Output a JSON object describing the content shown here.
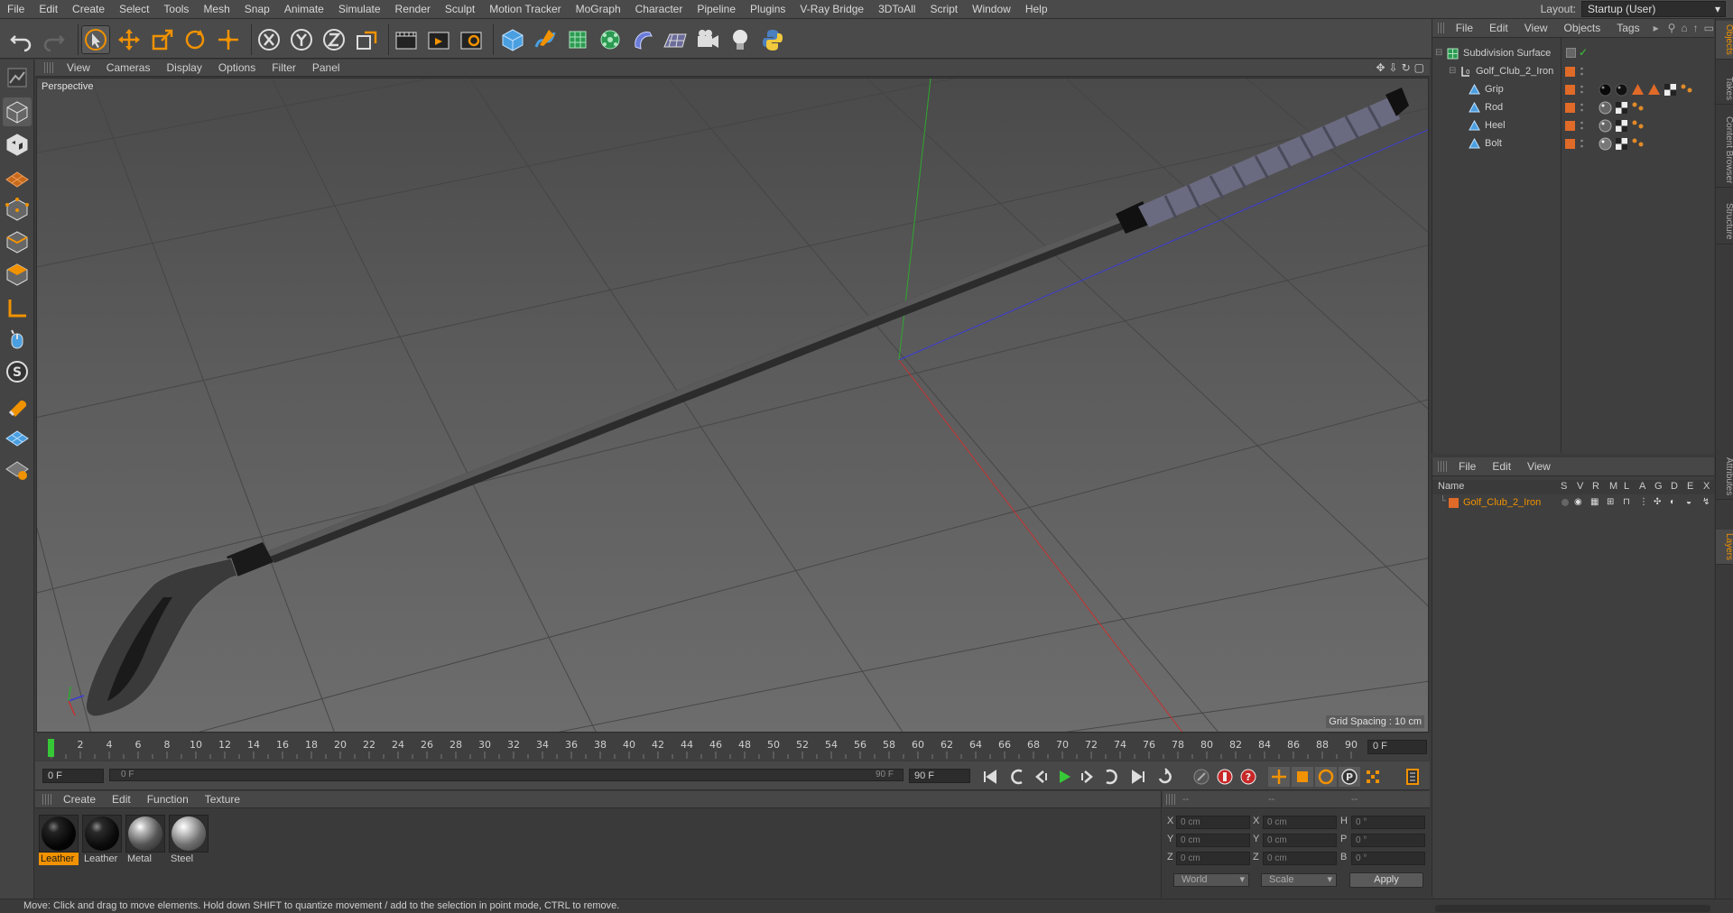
{
  "menu": [
    "File",
    "Edit",
    "Create",
    "Select",
    "Tools",
    "Mesh",
    "Snap",
    "Animate",
    "Simulate",
    "Render",
    "Sculpt",
    "Motion Tracker",
    "MoGraph",
    "Character",
    "Pipeline",
    "Plugins",
    "V-Ray Bridge",
    "3DToAll",
    "Script",
    "Window",
    "Help"
  ],
  "layout": {
    "label": "Layout:",
    "value": "Startup (User)"
  },
  "viewport": {
    "menu": [
      "View",
      "Cameras",
      "Display",
      "Options",
      "Filter",
      "Panel"
    ],
    "label": "Perspective",
    "grid_spacing": "Grid Spacing : 10 cm"
  },
  "timeline": {
    "ticks": [
      "0",
      "2",
      "4",
      "6",
      "8",
      "10",
      "12",
      "14",
      "16",
      "18",
      "20",
      "22",
      "24",
      "26",
      "28",
      "30",
      "32",
      "34",
      "36",
      "38",
      "40",
      "42",
      "44",
      "46",
      "48",
      "50",
      "52",
      "54",
      "56",
      "58",
      "60",
      "62",
      "64",
      "66",
      "68",
      "70",
      "72",
      "74",
      "76",
      "78",
      "80",
      "82",
      "84",
      "86",
      "88",
      "90"
    ],
    "current_frame": "0 F",
    "start_field": "0 F",
    "scrub_start": "0 F",
    "scrub_end": "90 F",
    "end_field": "90 F"
  },
  "materials": {
    "menu": [
      "Create",
      "Edit",
      "Function",
      "Texture"
    ],
    "items": [
      {
        "name": "Leather",
        "color": "#0c0c0c",
        "selected": true
      },
      {
        "name": "Leather",
        "color": "#141414",
        "selected": false
      },
      {
        "name": "Metal",
        "color": "#7a7a7a",
        "selected": false
      },
      {
        "name": "Steel",
        "color": "#9a9a9a",
        "selected": false
      }
    ]
  },
  "coords": {
    "header": [
      "--",
      "--",
      "--"
    ],
    "rows": [
      {
        "a": "X",
        "av": "0 cm",
        "b": "X",
        "bv": "0 cm",
        "c": "H",
        "cv": "0 °"
      },
      {
        "a": "Y",
        "av": "0 cm",
        "b": "Y",
        "bv": "0 cm",
        "c": "P",
        "cv": "0 °"
      },
      {
        "a": "Z",
        "av": "0 cm",
        "b": "Z",
        "bv": "0 cm",
        "c": "B",
        "cv": "0 °"
      }
    ],
    "mode": "World",
    "scale": "Scale",
    "apply": "Apply"
  },
  "objects": {
    "menu": [
      "File",
      "Edit",
      "View",
      "Objects",
      "Tags"
    ],
    "tree": [
      {
        "name": "Subdivision Surface",
        "indent": 0
      },
      {
        "name": "Golf_Club_2_Iron",
        "indent": 1
      },
      {
        "name": "Grip",
        "indent": 2
      },
      {
        "name": "Rod",
        "indent": 2
      },
      {
        "name": "Heel",
        "indent": 2
      },
      {
        "name": "Bolt",
        "indent": 2
      }
    ]
  },
  "layers": {
    "menu": [
      "File",
      "Edit",
      "View"
    ],
    "columns": {
      "name": "Name",
      "flags": [
        "S",
        "V",
        "R",
        "M",
        "L",
        "A",
        "G",
        "D",
        "E",
        "X"
      ]
    },
    "rows": [
      {
        "name": "Golf_Club_2_Iron",
        "color": "#e06a28"
      }
    ]
  },
  "side_tabs": [
    "Objects",
    "Takes",
    "Content Browser",
    "Structure",
    "Attributes",
    "Layers"
  ],
  "status": "Move: Click and drag to move elements. Hold down SHIFT to quantize movement / add to the selection in point mode, CTRL to remove.",
  "colors": {
    "accent": "#f19200",
    "selection": "#f19200",
    "bg": "#3b3b3b"
  }
}
